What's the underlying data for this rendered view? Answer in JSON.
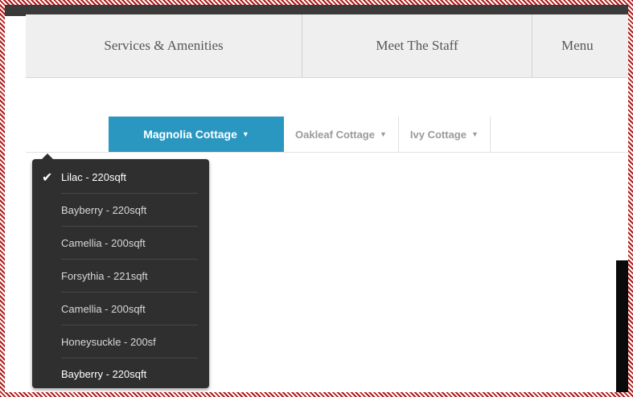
{
  "nav": {
    "items": [
      "Services & Amenities",
      "Meet The Staff",
      "Menu"
    ]
  },
  "tabs": {
    "items": [
      {
        "label": "Magnolia Cottage",
        "caret": "▼",
        "active": true
      },
      {
        "label": "Oakleaf Cottage",
        "caret": "▼",
        "active": false
      },
      {
        "label": "Ivy Cottage",
        "caret": "▼",
        "active": false
      }
    ]
  },
  "dropdown": {
    "check": "✔",
    "items": [
      {
        "label": "Lilac - 220sqft",
        "selected": true
      },
      {
        "label": "Bayberry - 220sqft",
        "selected": false
      },
      {
        "label": "Camellia - 200sqft",
        "selected": false
      },
      {
        "label": "Forsythia - 221sqft",
        "selected": false
      },
      {
        "label": "Camellia - 200sqft",
        "selected": false
      },
      {
        "label": "Honeysuckle - 200sf",
        "selected": false
      },
      {
        "label": "Bayberry - 220sqft",
        "selected": false
      }
    ]
  },
  "colors": {
    "active_tab": "#2a97c1",
    "dropdown_bg": "#2f2f2f",
    "nav_bg": "#efefef",
    "frame_border": "#b01c1c"
  }
}
